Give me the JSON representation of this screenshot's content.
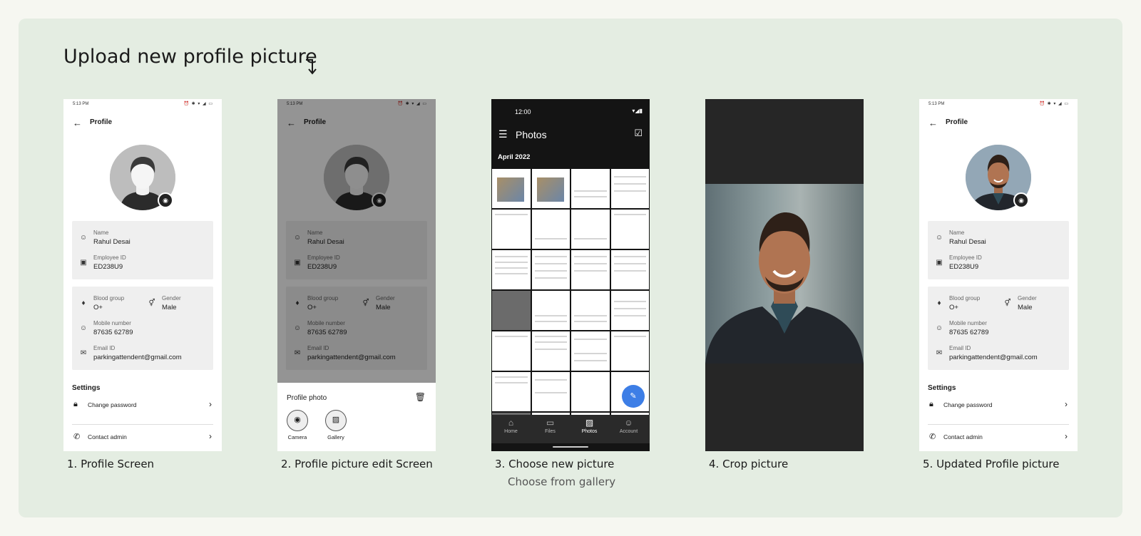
{
  "title": "Upload new profile picture",
  "profile": {
    "status_time": "5:13 PM",
    "app_title": "Profile",
    "name_label": "Name",
    "name_value": "Rahul Desai",
    "employee_label": "Employee ID",
    "employee_value": "ED238U9",
    "blood_label": "Blood group",
    "blood_value": "O+",
    "gender_label": "Gender",
    "gender_value": "Male",
    "mobile_label": "Mobile number",
    "mobile_value": "87635 62789",
    "email_label": "Email ID",
    "email_value": "parkingattendent@gmail.com",
    "settings_title": "Settings",
    "change_password": "Change password",
    "contact_admin": "Contact admin"
  },
  "edit_sheet": {
    "title": "Profile photo",
    "camera_label": "Camera",
    "gallery_label": "Gallery"
  },
  "photos": {
    "status_time": "12:00",
    "app_title": "Photos",
    "month": "April 2022",
    "nav": [
      "Home",
      "Files",
      "Photos",
      "Account"
    ]
  },
  "captions": {
    "step1": "1. Profile Screen",
    "step2": "2. Profile picture edit Screen",
    "step3": "3. Choose new picture",
    "step3_sub": "Choose from gallery",
    "step4": "4. Crop picture",
    "step5": "5. Updated Profile picture"
  },
  "colors": {
    "board_bg": "#e4ede2",
    "page_bg": "#f6f7f1",
    "fab_blue": "#3d7ee6"
  }
}
